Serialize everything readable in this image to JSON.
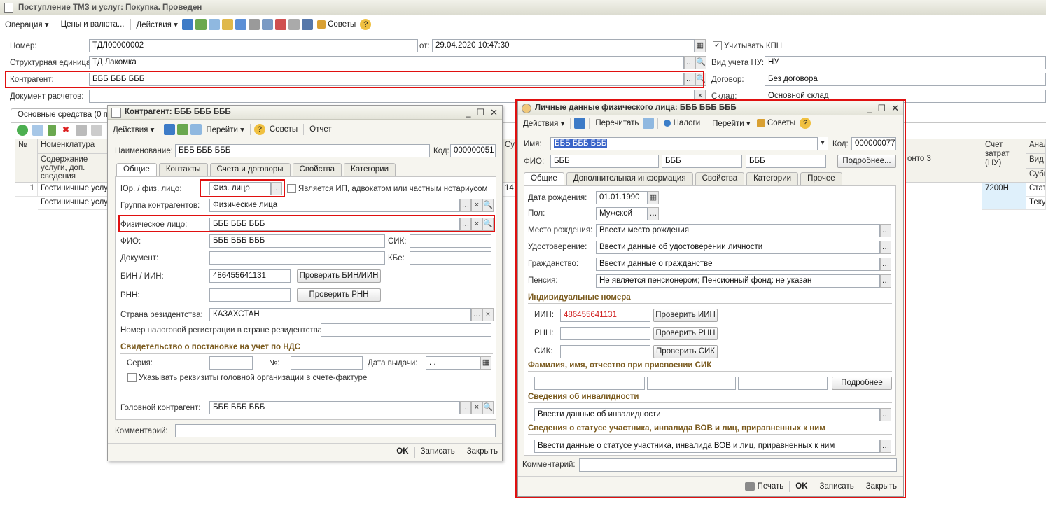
{
  "main": {
    "title": "Поступление ТМЗ и услуг: Покупка. Проведен",
    "toolbar": {
      "operation": "Операция",
      "prices": "Цены и валюта...",
      "actions": "Действия",
      "advice": "Советы"
    },
    "number_label": "Номер:",
    "number_value": "ТДЛ00000002",
    "date_label": "от:",
    "date_value": "29.04.2020 10:47:30",
    "kpn_label": "Учитывать КПН",
    "unit_label": "Структурная единица:",
    "unit_value": "ТД Лакомка",
    "nu_label": "Вид учета НУ:",
    "nu_value": "НУ",
    "counterparty_label": "Контрагент:",
    "counterparty_value": "БББ БББ БББ",
    "contract_label": "Договор:",
    "contract_value": "Без договора",
    "docpay_label": "Документ расчетов:",
    "warehouse_label": "Склад:",
    "warehouse_value": "Основной склад",
    "tab_assets": "Основные средства (0 по",
    "table": {
      "h_num": "№",
      "h_nom": "Номенклатура",
      "h_content": "Содержание услуги, доп. сведения",
      "h_su": "Су",
      "h_subconto": "онто 3",
      "h_account": "Счет затрат (НУ)",
      "h_an1": "Анал",
      "h_an2": "Вид",
      "h_an3": "Субк",
      "rows": [
        {
          "num": "1",
          "nom": "Гостиничные услуги",
          "qty": "14",
          "account": "7200Н",
          "an": "Стат"
        },
        {
          "num": "",
          "nom": "Гостиничные услуги",
          "qty": "",
          "account": "",
          "an": "Теку"
        }
      ]
    }
  },
  "counterparty_win": {
    "title": "Контрагент: БББ БББ БББ",
    "toolbar": {
      "actions": "Действия",
      "goto": "Перейти",
      "advice": "Советы",
      "report": "Отчет"
    },
    "name_label": "Наименование:",
    "name_value": "БББ БББ БББ",
    "code_label": "Код:",
    "code_value": "000000051",
    "tabs": [
      "Общие",
      "Контакты",
      "Счета и договоры",
      "Свойства",
      "Категории"
    ],
    "legal_label": "Юр. / физ. лицо:",
    "legal_value": "Физ. лицо",
    "ip_label": "Является ИП, адвокатом или частным нотариусом",
    "group_label": "Группа контрагентов:",
    "group_value": "Физические лица",
    "person_label": "Физическое лицо:",
    "person_value": "БББ БББ БББ",
    "fio_label": "ФИО:",
    "fio_value": "БББ БББ БББ",
    "sik_label": "СИК:",
    "doc_label": "Документ:",
    "kbe_label": "КБе:",
    "bin_label": "БИН / ИИН:",
    "bin_value": "486455641131",
    "check_bin": "Проверить БИН/ИИН",
    "rnn_label": "РНН:",
    "check_rnn": "Проверить РНН",
    "country_label": "Страна резидентства:",
    "country_value": "КАЗАХСТАН",
    "taxreg_label": "Номер налоговой регистрации в стране резидентства:",
    "nds_header": "Свидетельство о постановке на учет по НДС",
    "series_label": "Серия:",
    "no_label": "№:",
    "issue_label": "Дата выдачи:",
    "issue_value": " .  .",
    "head_org_label": "Указывать реквизиты головной организации в счете-фактуре",
    "head_label": "Головной контрагент:",
    "head_value": "БББ БББ БББ",
    "comment_label": "Комментарий:",
    "ok": "OK",
    "save": "Записать",
    "close": "Закрыть"
  },
  "person_win": {
    "title": "Личные данные физического лица: БББ БББ БББ",
    "toolbar": {
      "actions": "Действия",
      "reread": "Перечитать",
      "taxes": "Налоги",
      "goto": "Перейти",
      "advice": "Советы"
    },
    "name_label": "Имя:",
    "name_value": "БББ БББ БББ",
    "code_label": "Код:",
    "code_value": "000000077",
    "fio_label": "ФИО:",
    "fio1": "БББ",
    "fio2": "БББ",
    "fio3": "БББ",
    "more": "Подробнее...",
    "tabs": [
      "Общие",
      "Дополнительная информация",
      "Свойства",
      "Категории",
      "Прочее"
    ],
    "birth_label": "Дата рождения:",
    "birth_value": "01.01.1990",
    "sex_label": "Пол:",
    "sex_value": "Мужской",
    "birthplace_label": "Место рождения:",
    "birthplace_value": "Ввести место рождения",
    "id_label": "Удостоверение:",
    "id_value": "Ввести данные об удостоверении личности",
    "citizen_label": "Гражданство:",
    "citizen_value": "Ввести данные о гражданстве",
    "pension_label": "Пенсия:",
    "pension_value": "Не является пенсионером; Пенсионный фонд: не указан",
    "ind_header": "Индивидуальные номера",
    "iin_label": "ИИН:",
    "iin_value": "486455641131",
    "check_iin": "Проверить ИИН",
    "rnn_label": "РНН:",
    "check_rnn": "Проверить РНН",
    "sik_label": "СИК:",
    "check_sik": "Проверить СИК",
    "fio_sik_header": "Фамилия, имя, отчество при присвоении СИК",
    "more2": "Подробнее",
    "disab_header": "Сведения об инвалидности",
    "disab_value": "Ввести данные об инвалидности",
    "vov_header": "Сведения о статусе участника, инвалида ВОВ и лиц, приравненных к ним",
    "vov_value": "Ввести данные о статусе участника, инвалида ВОВ и лиц, приравненных к ним",
    "comment_label": "Комментарий:",
    "print": "Печать",
    "ok": "OK",
    "save": "Записать",
    "close": "Закрыть"
  }
}
